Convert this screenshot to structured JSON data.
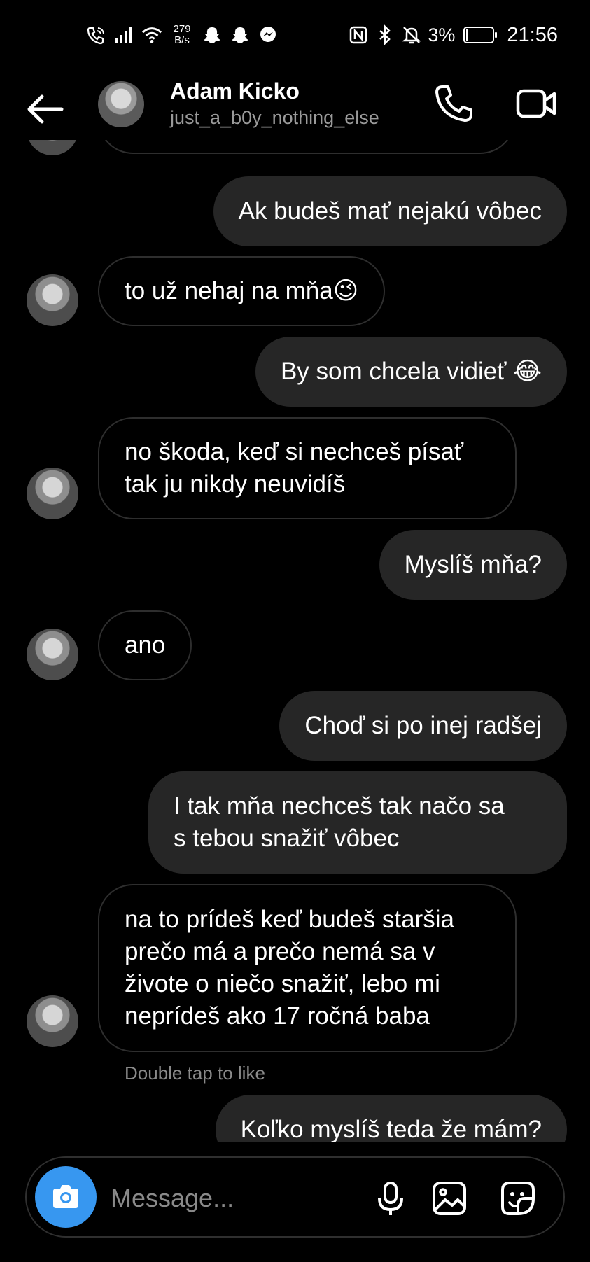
{
  "status_bar": {
    "net_speed_value": "279",
    "net_speed_unit": "B/s",
    "battery_percent": "3%",
    "battery_level": 0.03,
    "time": "21:56",
    "icons_left": [
      "wifi-calling-icon",
      "signal-icon",
      "wifi-icon",
      "snapchat-icon",
      "snapchat-icon",
      "messenger-icon"
    ],
    "icons_right": [
      "nfc-icon",
      "bluetooth-icon",
      "bell-muted-icon",
      "battery-icon"
    ]
  },
  "header": {
    "contact_name": "Adam Kicko",
    "contact_handle": "just_a_b0y_nothing_else"
  },
  "messages": [
    {
      "from": "me",
      "text": "Ak budeš mať nejakú vôbec"
    },
    {
      "from": "them",
      "text": "to už nehaj na mňa😉"
    },
    {
      "from": "me",
      "text": "By som chcela vidieť 😂"
    },
    {
      "from": "them",
      "line1": "no škoda, keď si nechceš písať",
      "line2": "tak ju nikdy neuvidíš"
    },
    {
      "from": "me",
      "text": "Myslíš mňa?"
    },
    {
      "from": "them",
      "text": "ano"
    },
    {
      "from": "me",
      "text": "Choď si po inej radšej"
    },
    {
      "from": "me",
      "line1": "I tak mňa nechceš tak načo sa",
      "line2": "s tebou snažiť vôbec"
    },
    {
      "from": "them",
      "line1": "na to prídeš keď budeš staršia",
      "line2": "prečo má a prečo nemá sa v",
      "line3": "živote o niečo snažiť, lebo mi",
      "line4": "neprídeš ako 17 ročná baba"
    },
    {
      "from": "me",
      "text": "Koľko myslíš teda že mám?"
    }
  ],
  "hint": "Double tap to like",
  "composer": {
    "placeholder": "Message..."
  }
}
